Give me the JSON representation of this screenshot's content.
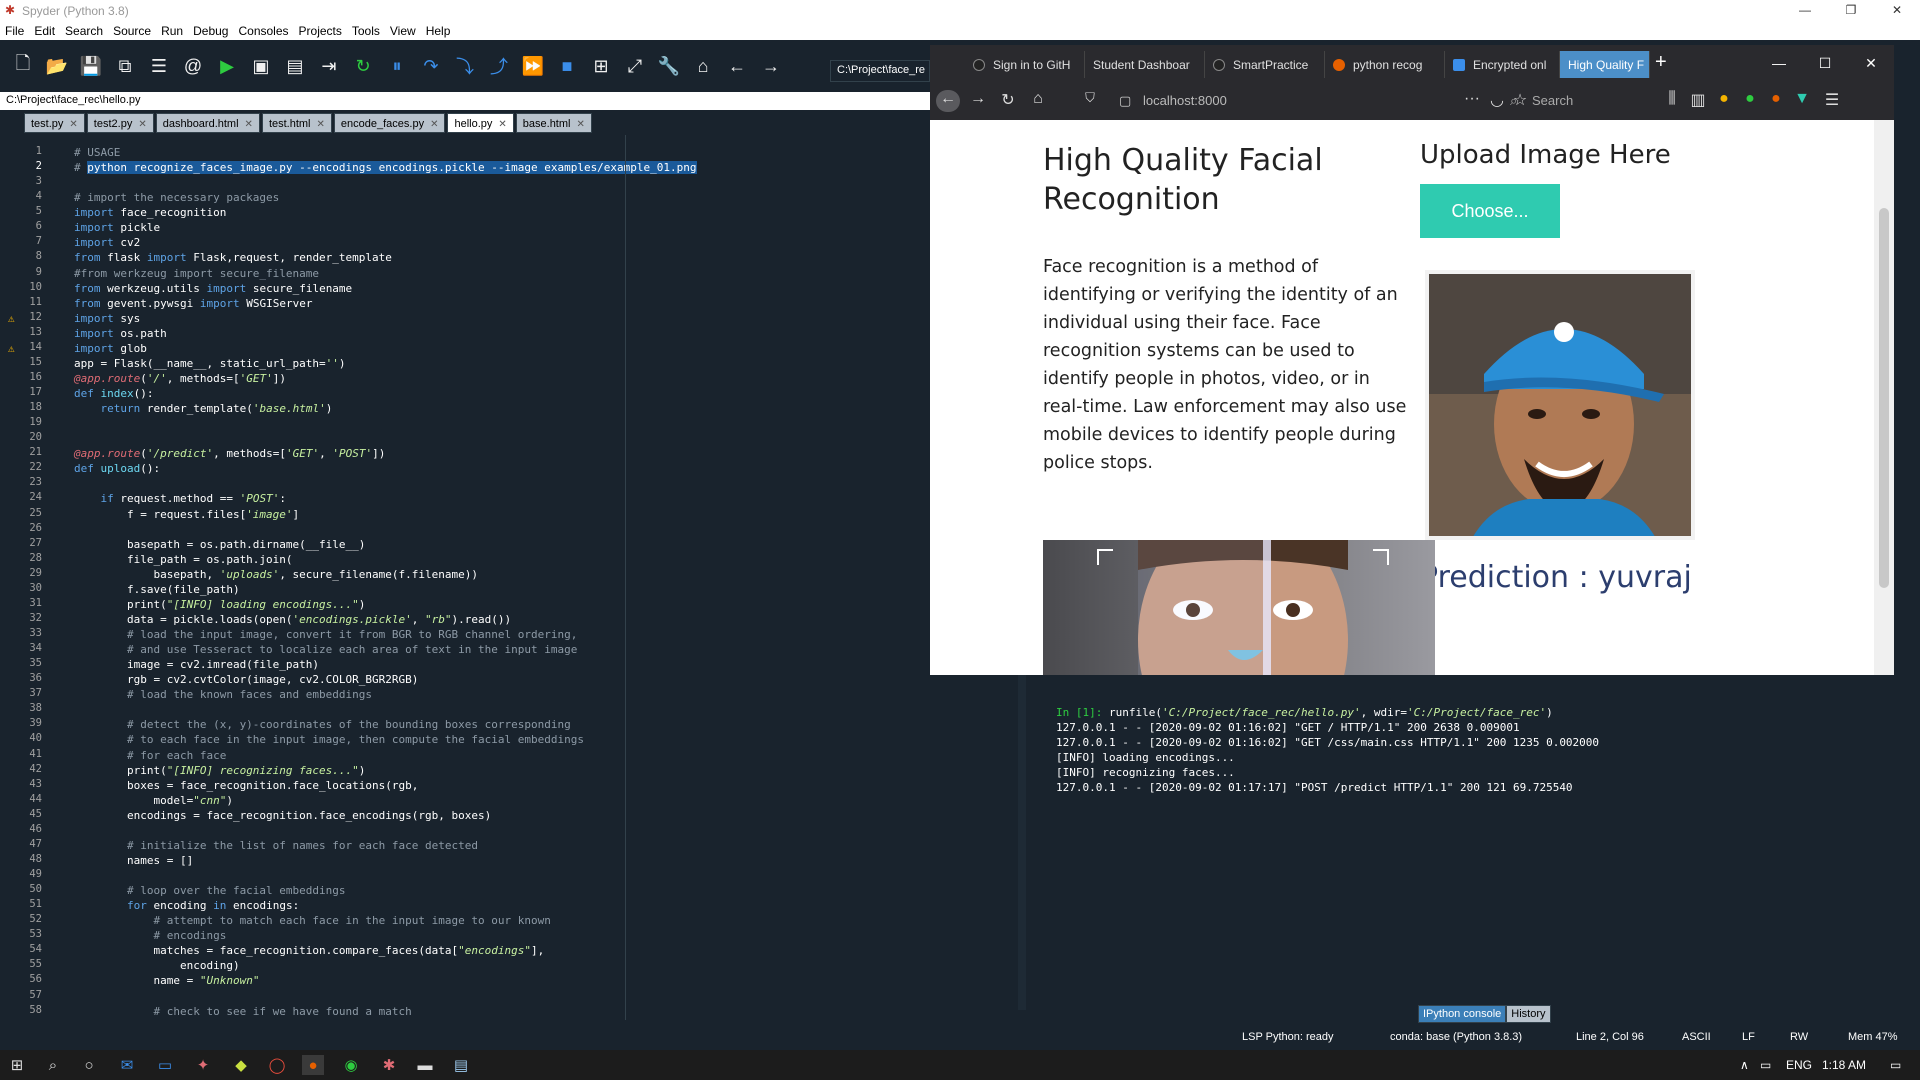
{
  "window_title": "Spyder (Python 3.8)",
  "menu": [
    "File",
    "Edit",
    "Search",
    "Source",
    "Run",
    "Debug",
    "Consoles",
    "Projects",
    "Tools",
    "View",
    "Help"
  ],
  "toolbar_path": "C:\\Project\\face_re",
  "file_path": "C:\\Project\\face_rec\\hello.py",
  "editor_tabs": [
    "test.py",
    "test2.py",
    "dashboard.html",
    "test.html",
    "encode_faces.py",
    "hello.py",
    "base.html"
  ],
  "active_tab": "hello.py",
  "code_lines": [
    "# USAGE",
    "# python recognize_faces_image.py --encodings encodings.pickle --image examples/example_01.png",
    "",
    "# import the necessary packages",
    "import face_recognition",
    "import pickle",
    "import cv2",
    "from flask import Flask,request, render_template",
    "#from werkzeug import secure_filename",
    "from werkzeug.utils import secure_filename",
    "from gevent.pywsgi import WSGIServer",
    "import sys",
    "import os.path",
    "import glob",
    "app = Flask(__name__, static_url_path='')",
    "@app.route('/', methods=['GET'])",
    "def index():",
    "    return render_template('base.html')",
    "",
    "",
    "@app.route('/predict', methods=['GET', 'POST'])",
    "def upload():",
    "",
    "    if request.method == 'POST':",
    "        f = request.files['image']",
    "",
    "        basepath = os.path.dirname(__file__)",
    "        file_path = os.path.join(",
    "            basepath, 'uploads', secure_filename(f.filename))",
    "        f.save(file_path)",
    "        print(\"[INFO] loading encodings...\")",
    "        data = pickle.loads(open('encodings.pickle', \"rb\").read())",
    "        # load the input image, convert it from BGR to RGB channel ordering,",
    "        # and use Tesseract to localize each area of text in the input image",
    "        image = cv2.imread(file_path)",
    "        rgb = cv2.cvtColor(image, cv2.COLOR_BGR2RGB)",
    "        # load the known faces and embeddings",
    "",
    "        # detect the (x, y)-coordinates of the bounding boxes corresponding",
    "        # to each face in the input image, then compute the facial embeddings",
    "        # for each face",
    "        print(\"[INFO] recognizing faces...\")",
    "        boxes = face_recognition.face_locations(rgb,",
    "            model=\"cnn\")",
    "        encodings = face_recognition.face_encodings(rgb, boxes)",
    "",
    "        # initialize the list of names for each face detected",
    "        names = []",
    "",
    "        # loop over the facial embeddings",
    "        for encoding in encodings:",
    "            # attempt to match each face in the input image to our known",
    "            # encodings",
    "            matches = face_recognition.compare_faces(data[\"encodings\"],",
    "                encoding)",
    "            name = \"Unknown\"",
    "",
    "            # check to see if we have found a match"
  ],
  "warning_lines": [
    12,
    14
  ],
  "current_line": 2,
  "console": {
    "prompt": "In [1]:",
    "command": " runfile('C:/Project/face_rec/hello.py', wdir='C:/Project/face_rec')",
    "lines": [
      "127.0.0.1 - - [2020-09-02 01:16:02] \"GET / HTTP/1.1\" 200 2638 0.009001",
      "127.0.0.1 - - [2020-09-02 01:16:02] \"GET /css/main.css HTTP/1.1\" 200 1235 0.002000",
      "[INFO] loading encodings...",
      "[INFO] recognizing faces...",
      "127.0.0.1 - - [2020-09-02 01:17:17] \"POST /predict HTTP/1.1\" 200 121 69.725540"
    ],
    "tabs": [
      "IPython console",
      "History"
    ]
  },
  "status": {
    "lsp": "LSP Python: ready",
    "conda": "conda: base (Python 3.8.3)",
    "position": "Line 2, Col 96",
    "encoding": "ASCII",
    "eol": "LF",
    "rw": "RW",
    "mem": "Mem 47%"
  },
  "browser": {
    "tabs": [
      "Sign in to GitH",
      "Student Dashboar",
      "SmartPractice",
      "python recog",
      "Encrypted onl",
      "High Quality F"
    ],
    "url": "localhost:8000",
    "search_placeholder": "Search",
    "page": {
      "title": "High Quality Facial Recognition",
      "description": "Face recognition is a method of identifying or verifying the identity of an individual using their face. Face recognition systems can be used to identify people in photos, video, or in real-time. Law enforcement may also use mobile devices to identify people during police stops.",
      "upload_heading": "Upload Image Here",
      "choose_button": "Choose...",
      "prediction": "Prediction : yuvraj"
    }
  },
  "taskbar": {
    "lang": "ENG",
    "time": "1:18 AM"
  },
  "colors": {
    "ide_bg": "#19232d",
    "accent_teal": "#2fcbb0",
    "prediction": "#2c3e6e",
    "browser_chrome": "#2a2a2e"
  }
}
